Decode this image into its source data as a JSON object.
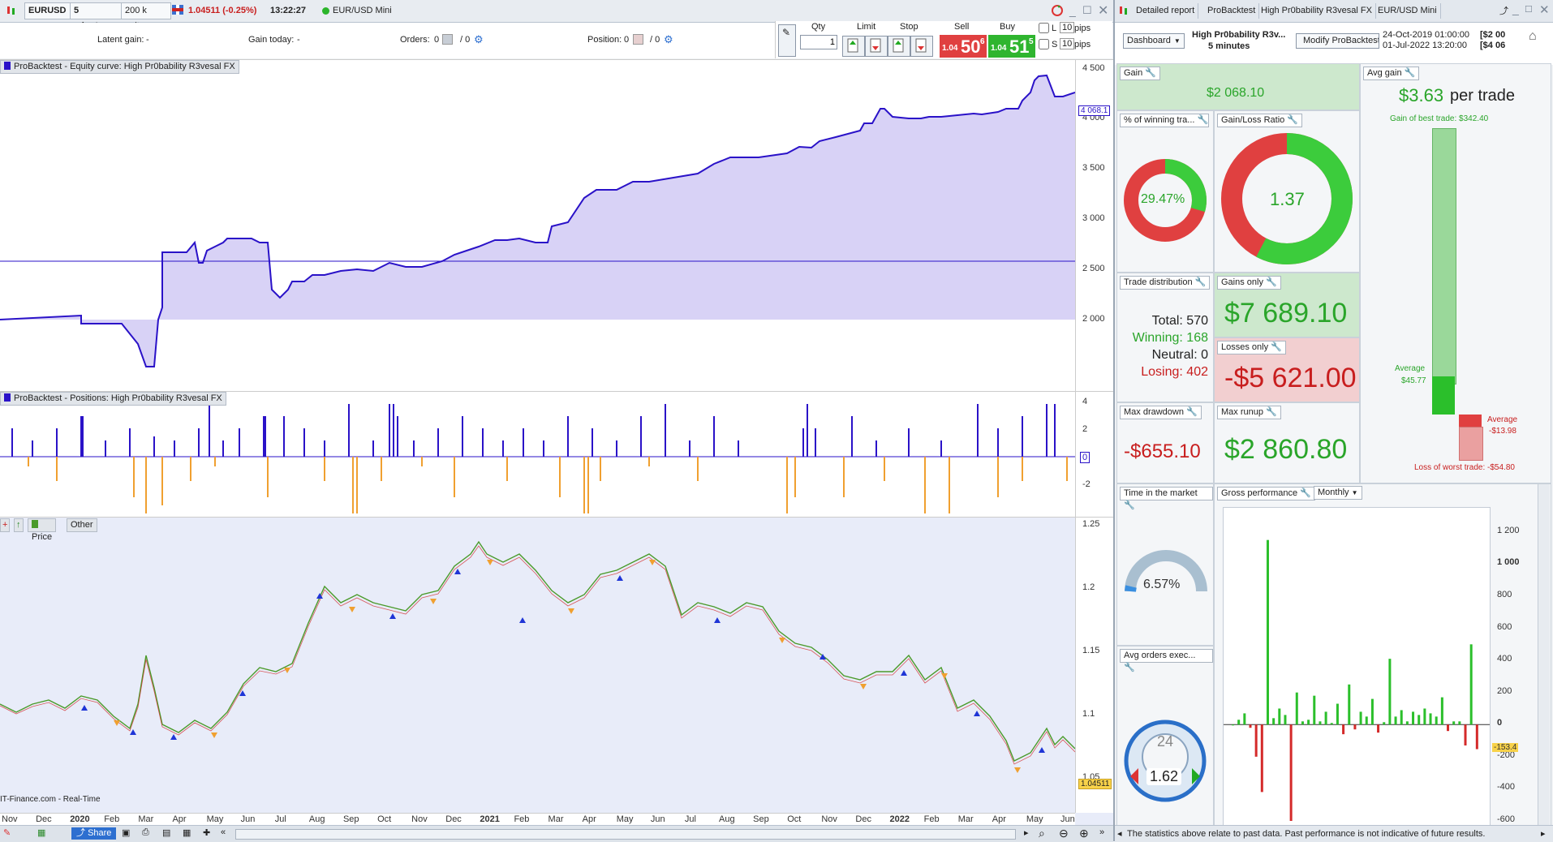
{
  "toolbar": {
    "symbol": "EURUSD",
    "timeframe": "5 minutes",
    "units": "200 k units",
    "price_change": "1.04511 (-0.25%)",
    "time": "13:22:27",
    "instrument": "EUR/USD Mini"
  },
  "info": {
    "latent_gain_label": "Latent gain:",
    "latent_gain_value": "-",
    "gain_today_label": "Gain today:",
    "gain_today_value": "-",
    "orders_label": "Orders:",
    "orders_value": "0",
    "orders_value2": "/ 0",
    "position_label": "Position:",
    "position_value": "0",
    "position_value2": "/ 0"
  },
  "order_box": {
    "qty_label": "Qty",
    "qty_value": "1",
    "limit_label": "Limit",
    "stop_label": "Stop",
    "sell_label": "Sell",
    "buy_label": "Buy",
    "sell_price_small": "1.04",
    "sell_price_big": "50",
    "sell_price_sup": "6",
    "buy_price_small": "1.04",
    "buy_price_big": "51",
    "buy_price_sup": "5",
    "l_label": "L",
    "s_label": "S",
    "pips_value": "10",
    "pips_label": "pips"
  },
  "equity_chart": {
    "label": "ProBacktest - Equity curve: High Pr0bability R3vesal FX",
    "current_value": "4 068.1",
    "y_ticks": [
      "4 500",
      "4 000",
      "3 500",
      "3 000",
      "2 500",
      "2 000"
    ]
  },
  "positions_chart": {
    "label": "ProBacktest - Positions: High Pr0bability R3vesal FX",
    "y_ticks": [
      "4",
      "2",
      "0",
      "-2"
    ]
  },
  "price_chart": {
    "tab_price": "Price",
    "tab_other": "Other",
    "current_value": "1.04511",
    "y_ticks": [
      "1.25",
      "1.2",
      "1.15",
      "1.1",
      "1.05"
    ],
    "source": "IT-Finance.com - Real-Time",
    "x_ticks": [
      "Nov",
      "Dec",
      "2020",
      "Feb",
      "Mar",
      "Apr",
      "May",
      "Jun",
      "Jul",
      "Aug",
      "Sep",
      "Oct",
      "Nov",
      "Dec",
      "2021",
      "Feb",
      "Mar",
      "Apr",
      "May",
      "Jun",
      "Jul",
      "Aug",
      "Sep",
      "Oct",
      "Nov",
      "Dec",
      "2022",
      "Feb",
      "Mar",
      "Apr",
      "May",
      "Jun"
    ]
  },
  "bottom": {
    "share_label": "Share"
  },
  "right_tabs": [
    "Detailed report",
    "ProBacktest",
    "High Pr0bability R3vesal FX",
    "EUR/USD Mini"
  ],
  "dashboard": {
    "dropdown": "Dashboard",
    "system_name": "High Pr0bability R3v...",
    "system_tf": "5 minutes",
    "modify_button": "Modify ProBacktest",
    "date_start": "24-Oct-2019 01:00:00",
    "date_end": "01-Jul-2022 13:20:00",
    "bracket1": "[$2 00",
    "bracket2": "[$4 06"
  },
  "panels": {
    "gain_title": "Gain",
    "gain_value": "$2 068.10",
    "avg_gain_title": "Avg gain",
    "avg_gain_value": "$3.63",
    "avg_gain_unit": "per trade",
    "best_trade": "Gain of best trade: $342.40",
    "avg_label": "Average",
    "avg_win": "$45.77",
    "avg_loss_label": "Average",
    "avg_loss": "-$13.98",
    "worst_trade": "Loss of worst trade: -$54.80",
    "winning_title": "% of winning tra...",
    "winning_value": "29.47%",
    "gl_title": "Gain/Loss Ratio",
    "gl_value": "1.37",
    "dist_title": "Trade distribution",
    "total_label": "Total:",
    "total_value": "570",
    "winning_label": "Winning:",
    "winning_count": "168",
    "neutral_label": "Neutral:",
    "neutral_value": "0",
    "losing_label": "Losing:",
    "losing_value": "402",
    "gains_only_title": "Gains only",
    "gains_only_value": "$7 689.10",
    "losses_only_title": "Losses only",
    "losses_only_value": "-$5 621.00",
    "max_dd_title": "Max drawdown",
    "max_dd_value": "-$655.10",
    "max_runup_title": "Max runup",
    "max_runup_value": "$2 860.80",
    "time_market_title": "Time in the market",
    "time_market_value": "6.57%",
    "gross_title": "Gross performance",
    "gross_period": "Monthly",
    "avg_orders_title": "Avg orders exec...",
    "avg_orders_value": "1.62",
    "avg_orders_dial": "24"
  },
  "status_text": "The statistics above relate to past data. Past performance is not indicative of future results.",
  "chart_data": {
    "type": "bar",
    "title": "",
    "xlabel": "",
    "ylabel": "",
    "ylim": [
      -600,
      1300
    ],
    "y_ticks": [
      "1 200",
      "1 000",
      "800",
      "600",
      "400",
      "200",
      "0",
      "-200",
      "-400",
      "-600"
    ],
    "current_marker": "-153.4",
    "values": [
      0,
      30,
      70,
      -20,
      -200,
      -420,
      1150,
      40,
      100,
      60,
      -600,
      200,
      20,
      30,
      180,
      20,
      80,
      10,
      130,
      -60,
      250,
      -30,
      80,
      50,
      160,
      -50,
      15,
      410,
      50,
      90,
      20,
      80,
      60,
      100,
      70,
      50,
      170,
      -40,
      20,
      20,
      -130,
      500,
      -153
    ]
  }
}
